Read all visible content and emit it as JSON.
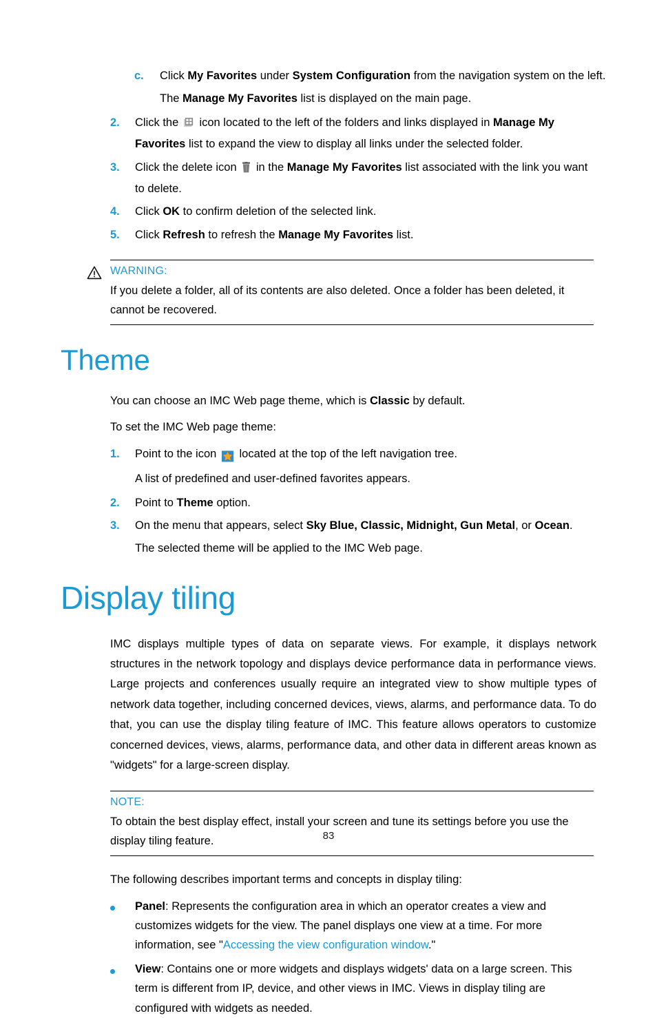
{
  "document": {
    "page_number": "83",
    "colors": {
      "heading_blue": "#1b9ad6",
      "marker_blue": "#1b9ad6",
      "link_blue": "#1b9ad6",
      "body_black": "#1a1a1a"
    }
  },
  "steps_favorites": {
    "step_c": {
      "marker": "c.",
      "text_1": "Click ",
      "bold_1": "My Favorites",
      "text_2": " under ",
      "bold_2": "System Configuration",
      "text_3": " from the navigation system on the left.",
      "result": {
        "text_1": "The ",
        "bold_1": "Manage My Favorites",
        "text_2": " list is displayed on the main page."
      }
    },
    "step_2": {
      "marker": "2.",
      "text_1": "Click the ",
      "icon": "expand-grid-icon",
      "text_2": " icon located to the left of the folders and links displayed in ",
      "bold_1": "Manage My Favorites",
      "text_3": " list to expand the view to display all links under the selected folder."
    },
    "step_3": {
      "marker": "3.",
      "text_1": "Click the delete icon ",
      "icon": "trash-icon",
      "text_2": " in the ",
      "bold_1": "Manage My Favorites",
      "text_3": " list associated with the link you want to delete."
    },
    "step_4": {
      "marker": "4.",
      "text_1": "Click ",
      "bold_1": "OK",
      "text_2": " to confirm deletion of the selected link."
    },
    "step_5": {
      "marker": "5.",
      "text_1": "Click ",
      "bold_1": "Refresh",
      "text_2": " to refresh the ",
      "bold_2": "Manage My Favorites",
      "text_3": " list."
    }
  },
  "warning_box": {
    "icon": "warning-triangle-icon",
    "title": "WARNING:",
    "body": "If you delete a folder, all of its contents are also deleted. Once a folder has been deleted, it cannot be recovered."
  },
  "theme_section": {
    "heading": "Theme",
    "intro_1": "You can choose an IMC Web page theme, which is ",
    "intro_1_bold": "Classic",
    "intro_1_end": " by default.",
    "intro_2": "To set the IMC Web page theme:",
    "step_1": {
      "marker": "1.",
      "text_1": "Point to the icon ",
      "icon": "favorites-star-icon",
      "text_2": " located at the top of the left navigation tree.",
      "result": "A list of predefined and user-defined favorites appears."
    },
    "step_2": {
      "marker": "2.",
      "text_1": "Point to ",
      "bold_1": "Theme",
      "text_2": " option."
    },
    "step_3": {
      "marker": "3.",
      "text_1": "On the menu that appears, select ",
      "bold_1": "Sky Blue, Classic, Midnight, Gun Metal",
      "text_2": ", or ",
      "bold_2": "Ocean",
      "text_3": ".",
      "result": "The selected theme will be applied to the IMC Web page."
    }
  },
  "display_tiling_section": {
    "heading": "Display tiling",
    "paragraph": "IMC displays multiple types of data on separate views. For example, it displays network structures in the network topology and displays device performance data in performance views. Large projects and conferences usually require an integrated view to show multiple types of network data together, including concerned devices, views, alarms, and performance data. To do that, you can use the display tiling feature of IMC. This feature allows operators to customize concerned devices, views, alarms, performance data, and other data in different areas known as \"widgets\" for a large-screen display.",
    "note_box": {
      "title": "NOTE:",
      "body": "To obtain the best display effect, install your screen and tune its settings before you use the display tiling feature."
    },
    "terms_intro": "The following describes important terms and concepts in display tiling:",
    "bullets": [
      {
        "term": "Panel",
        "text_1": ": Represents the configuration area in which an operator creates a view and customizes widgets for the view. The panel displays one view at a time. For more information, see \"",
        "link": "Accessing the view configuration window",
        "text_2": ".\""
      },
      {
        "term": "View",
        "text_1": ": Contains one or more widgets and displays widgets' data on a large screen. This term is different from IP, device, and other views in IMC. Views in display tiling are configured with widgets as needed.",
        "link": "",
        "text_2": ""
      }
    ]
  }
}
